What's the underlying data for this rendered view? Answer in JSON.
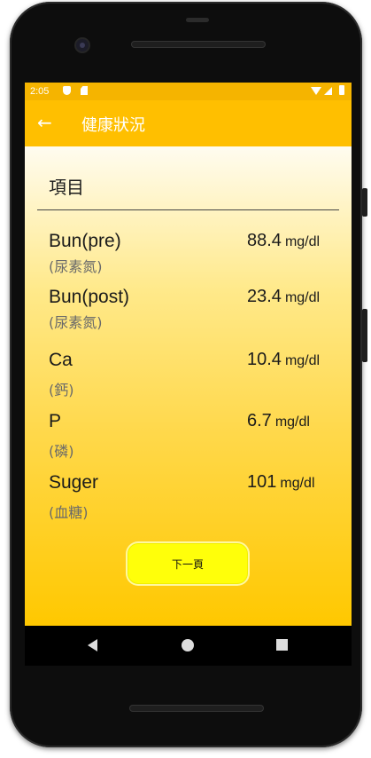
{
  "status_bar": {
    "time": "2:05"
  },
  "app_bar": {
    "back_icon": "←",
    "title": "健康狀況"
  },
  "section": {
    "title": "項目"
  },
  "items": [
    {
      "name": "Bun(pre)",
      "sub": "(尿素氮)",
      "value": "88.4",
      "unit": "mg/dl"
    },
    {
      "name": "Bun(post)",
      "sub": "(尿素氮)",
      "value": "23.4",
      "unit": "mg/dl"
    },
    {
      "name": "Ca",
      "sub": "(鈣)",
      "value": "10.4",
      "unit": "mg/dl"
    },
    {
      "name": "P",
      "sub": "(磷)",
      "value": "6.7",
      "unit": "mg/dl"
    },
    {
      "name": "Suger",
      "sub": "(血糖)",
      "value": "101",
      "unit": "mg/dl"
    }
  ],
  "next_button": {
    "label": "下一頁"
  },
  "colors": {
    "accent": "#ffbf00",
    "status_bar": "#f5b400",
    "button": "#ffff0a"
  }
}
